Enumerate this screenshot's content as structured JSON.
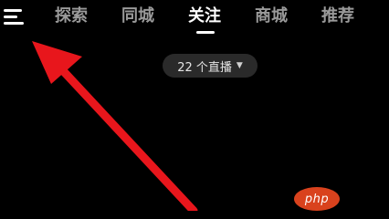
{
  "header": {
    "menu_icon": "hamburger-menu-icon",
    "tabs": [
      {
        "label": "探索",
        "active": false
      },
      {
        "label": "同城",
        "active": false
      },
      {
        "label": "关注",
        "active": true
      },
      {
        "label": "商城",
        "active": false
      },
      {
        "label": "推荐",
        "active": false
      }
    ]
  },
  "live": {
    "label": "22 个直播",
    "caret_icon": "caret-down-icon"
  },
  "annotation": {
    "arrow_color": "#e8161c"
  },
  "watermark": {
    "text": "php"
  }
}
